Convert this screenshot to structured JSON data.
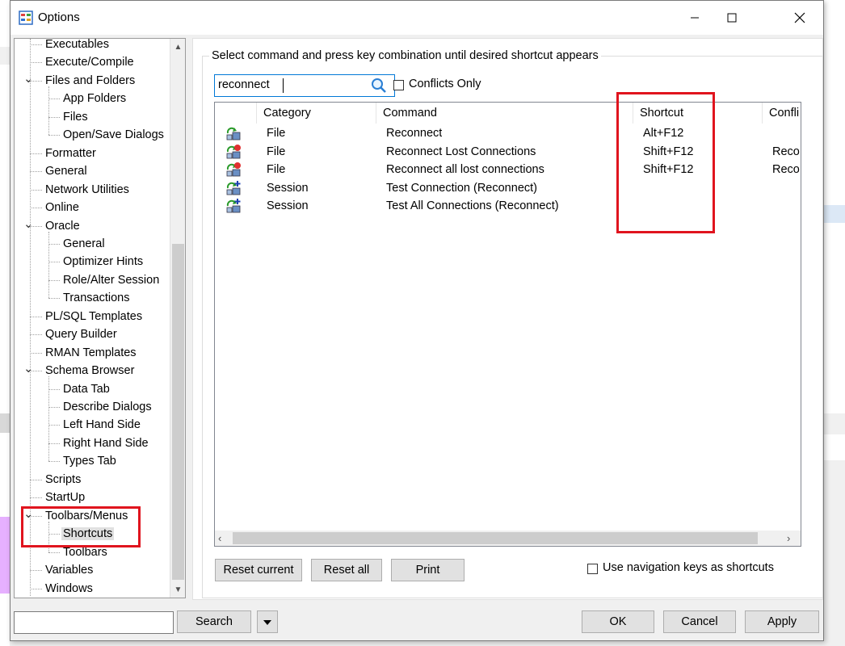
{
  "window": {
    "title": "Options"
  },
  "tree": {
    "items": [
      {
        "label": "Executables",
        "level": 1
      },
      {
        "label": "Execute/Compile",
        "level": 1
      },
      {
        "label": "Files and Folders",
        "level": 1,
        "expanded": true
      },
      {
        "label": "App Folders",
        "level": 2
      },
      {
        "label": "Files",
        "level": 2
      },
      {
        "label": "Open/Save Dialogs",
        "level": 2
      },
      {
        "label": "Formatter",
        "level": 1
      },
      {
        "label": "General",
        "level": 1
      },
      {
        "label": "Network Utilities",
        "level": 1
      },
      {
        "label": "Online",
        "level": 1
      },
      {
        "label": "Oracle",
        "level": 1,
        "expanded": true
      },
      {
        "label": "General",
        "level": 2
      },
      {
        "label": "Optimizer Hints",
        "level": 2
      },
      {
        "label": "Role/Alter Session",
        "level": 2
      },
      {
        "label": "Transactions",
        "level": 2
      },
      {
        "label": "PL/SQL Templates",
        "level": 1
      },
      {
        "label": "Query Builder",
        "level": 1
      },
      {
        "label": "RMAN Templates",
        "level": 1
      },
      {
        "label": "Schema Browser",
        "level": 1,
        "expanded": true
      },
      {
        "label": "Data Tab",
        "level": 2
      },
      {
        "label": "Describe Dialogs",
        "level": 2
      },
      {
        "label": "Left Hand Side",
        "level": 2
      },
      {
        "label": "Right Hand Side",
        "level": 2
      },
      {
        "label": "Types Tab",
        "level": 2
      },
      {
        "label": "Scripts",
        "level": 1
      },
      {
        "label": "StartUp",
        "level": 1
      },
      {
        "label": "Toolbars/Menus",
        "level": 1,
        "expanded": true
      },
      {
        "label": "Shortcuts",
        "level": 2,
        "selected": true
      },
      {
        "label": "Toolbars",
        "level": 2
      },
      {
        "label": "Variables",
        "level": 1
      },
      {
        "label": "Windows",
        "level": 1
      }
    ]
  },
  "shortcuts": {
    "group_caption": "Select command and press key combination until desired shortcut appears",
    "search_value": "reconnect",
    "conflicts_only_label": "Conflicts Only",
    "columns": [
      "Category",
      "Command",
      "Shortcut",
      "Confli"
    ],
    "rows": [
      {
        "category": "File",
        "command": "Reconnect",
        "shortcut": "Alt+F12",
        "conflict": "",
        "icon": "reconnect-icon"
      },
      {
        "category": "File",
        "command": "Reconnect Lost Connections",
        "shortcut": "Shift+F12",
        "conflict": "Reco",
        "icon": "reconnect-lost-icon"
      },
      {
        "category": "File",
        "command": "Reconnect all lost connections",
        "shortcut": "Shift+F12",
        "conflict": "Reco",
        "icon": "reconnect-lost-icon"
      },
      {
        "category": "Session",
        "command": "Test Connection (Reconnect)",
        "shortcut": "",
        "conflict": "",
        "icon": "test-connection-icon"
      },
      {
        "category": "Session",
        "command": "Test All Connections (Reconnect)",
        "shortcut": "",
        "conflict": "",
        "icon": "test-connection-icon"
      }
    ],
    "buttons": {
      "reset_current": "Reset current",
      "reset_all": "Reset all",
      "print": "Print"
    },
    "nav_keys_label": "Use navigation keys as shortcuts"
  },
  "footer": {
    "search_label": "Search",
    "ok_label": "OK",
    "cancel_label": "Cancel",
    "apply_label": "Apply"
  },
  "colors": {
    "highlight": "#e0141e",
    "focus": "#0078d7"
  }
}
